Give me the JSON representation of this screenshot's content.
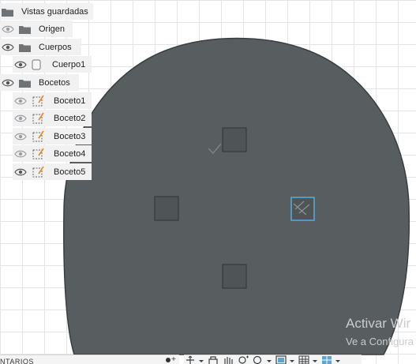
{
  "browser": {
    "saved_views": "Vistas guardadas",
    "origin": "Origen",
    "bodies": "Cuerpos",
    "body1": "Cuerpo1",
    "sketches": "Bocetos",
    "sketch_items": [
      "Boceto1",
      "Boceto2",
      "Boceto3",
      "Boceto4",
      "Boceto5"
    ]
  },
  "comments": {
    "label": "NTARIOS"
  },
  "watermark": {
    "line1": "Activar Wir",
    "line2": "Ve a Configura"
  },
  "colors": {
    "body_fill": "#585d5f",
    "body_edge": "#3a3e40",
    "pad_fill": "#4f5456",
    "selection": "#5aa6d4",
    "grid_line": "#e2e4e6",
    "browser_bg": "#f1f1f1"
  },
  "navigation_toolbar": {
    "icons": [
      "orbit-icon",
      "pan-icon",
      "hand-icon",
      "zoom-fit-icon",
      "zoom-icon",
      "display-mode-icon",
      "grid-icon",
      "viewports-icon"
    ]
  }
}
